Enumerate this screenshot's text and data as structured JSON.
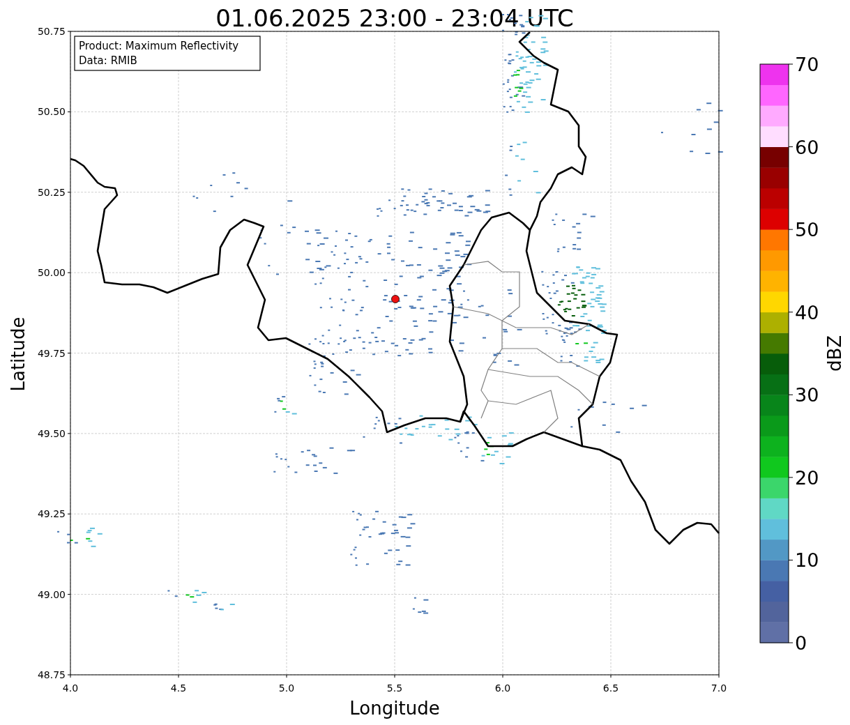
{
  "title": "01.06.2025 23:00 - 23:04 UTC",
  "info_box": [
    "Product: Maximum Reflectivity",
    "Data: RMIB"
  ],
  "x_axis": {
    "label": "Longitude",
    "ticks": [
      "4.0",
      "4.5",
      "5.0",
      "5.5",
      "6.0",
      "6.5",
      "7.0"
    ]
  },
  "y_axis": {
    "label": "Latitude",
    "ticks": [
      "50.75",
      "50.50",
      "50.25",
      "50.00",
      "49.75",
      "49.50",
      "49.25",
      "49.00",
      "48.75"
    ]
  },
  "colorbar": {
    "label": "dBZ",
    "ticks": [
      "70",
      "60",
      "50",
      "40",
      "30",
      "20",
      "10",
      "0"
    ],
    "bins": [
      {
        "color": "#6070a6"
      },
      {
        "color": "#52649c"
      },
      {
        "color": "#4560a3"
      },
      {
        "color": "#4a78b3"
      },
      {
        "color": "#5298c5"
      },
      {
        "color": "#60bfdc"
      },
      {
        "color": "#60d8c5"
      },
      {
        "color": "#3bd66b"
      },
      {
        "color": "#10c81e"
      },
      {
        "color": "#0db21e"
      },
      {
        "color": "#0a9a1a"
      },
      {
        "color": "#08851a"
      },
      {
        "color": "#077015"
      },
      {
        "color": "#075d0a"
      },
      {
        "color": "#457a00"
      },
      {
        "color": "#adb000"
      },
      {
        "color": "#ffd700"
      },
      {
        "color": "#ffb300"
      },
      {
        "color": "#ff9900"
      },
      {
        "color": "#ff7700"
      },
      {
        "color": "#dd0000"
      },
      {
        "color": "#bb0000"
      },
      {
        "color": "#990000"
      },
      {
        "color": "#770000"
      },
      {
        "color": "#ffddff"
      },
      {
        "color": "#ffaaff"
      },
      {
        "color": "#ff66ff"
      },
      {
        "color": "#ee33ee"
      }
    ]
  }
}
